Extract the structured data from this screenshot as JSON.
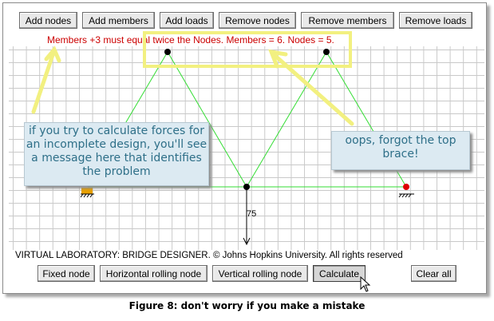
{
  "toolbar_top": {
    "add_nodes": "Add nodes",
    "add_members": "Add members",
    "add_loads": "Add loads",
    "remove_nodes": "Remove nodes",
    "remove_members": "Remove members",
    "remove_loads": "Remove loads"
  },
  "status_message": "Members +3 must equal twice the Nodes.  Members = 6.  Nodes = 5.",
  "load_label": "75",
  "copyright": "VIRTUAL LABORATORY: BRIDGE DESIGNER. © Johns Hopkins University. All rights reserved",
  "toolbar_bottom": {
    "fixed_node": "Fixed node",
    "horizontal_rolling_node": "Horizontal rolling node",
    "vertical_rolling_node": "Vertical rolling node",
    "calculate": "Calculate",
    "clear_all": "Clear all"
  },
  "callouts": {
    "left": "if you try to calculate forces for an incomplete design, you'll see a message here that identifies the problem",
    "right": "oops, forgot the top brace!"
  },
  "caption": "Figure 8: don't worry if you make a mistake",
  "colors": {
    "member": "#33dd33",
    "node": "#000000",
    "selected_node": "#dd0000",
    "support": "#e8a000",
    "message": "#cc0000",
    "annotation_yellow": "#f2f080",
    "callout_text": "#2e6f88"
  }
}
